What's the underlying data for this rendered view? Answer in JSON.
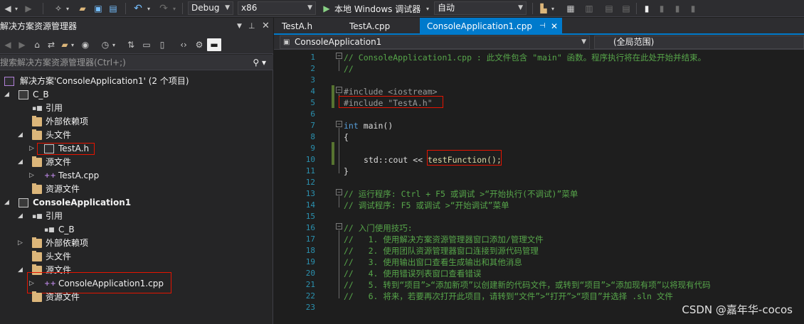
{
  "toolbar": {
    "config": "Debug",
    "platform": "x86",
    "run_label": "本地 Windows 调试器",
    "auto_label": "自动"
  },
  "solution_explorer": {
    "title": "解决方案资源管理器",
    "search_placeholder": "搜索解决方案资源管理器(Ctrl+;)",
    "tree": [
      {
        "label": "解决方案'ConsoleApplication1' (2 个项目)",
        "icon": "solution-icon"
      },
      {
        "label": "C_B",
        "icon": "project-icon"
      },
      {
        "label": "引用",
        "icon": "references-icon"
      },
      {
        "label": "外部依赖项",
        "icon": "external-deps-icon"
      },
      {
        "label": "头文件",
        "icon": "folder-icon"
      },
      {
        "label": "TestA.h",
        "icon": "header-file-icon"
      },
      {
        "label": "源文件",
        "icon": "folder-icon"
      },
      {
        "label": "TestA.cpp",
        "icon": "cpp-file-icon"
      },
      {
        "label": "资源文件",
        "icon": "folder-icon"
      },
      {
        "label": "ConsoleApplication1",
        "icon": "project-icon"
      },
      {
        "label": "引用",
        "icon": "references-icon"
      },
      {
        "label": "C_B",
        "icon": "reference-item-icon"
      },
      {
        "label": "外部依赖项",
        "icon": "external-deps-icon"
      },
      {
        "label": "头文件",
        "icon": "folder-icon"
      },
      {
        "label": "源文件",
        "icon": "folder-icon"
      },
      {
        "label": "ConsoleApplication1.cpp",
        "icon": "cpp-file-icon"
      },
      {
        "label": "资源文件",
        "icon": "folder-icon"
      }
    ]
  },
  "editor": {
    "tabs": [
      {
        "label": "TestA.h"
      },
      {
        "label": "TestA.cpp"
      },
      {
        "label": "ConsoleApplication1.cpp"
      }
    ],
    "nav_project": "ConsoleApplication1",
    "nav_scope": "(全局范围)",
    "line_numbers": [
      "1",
      "2",
      "3",
      "4",
      "5",
      "6",
      "7",
      "8",
      "9",
      "10",
      "11",
      "12",
      "13",
      "14",
      "15",
      "16",
      "17",
      "18",
      "19",
      "20",
      "21",
      "22",
      "23"
    ],
    "lines": {
      "l1": "// ConsoleApplication1.cpp : 此文件包含 \"main\" 函数。程序执行将在此处开始并结束。",
      "l2": "//",
      "l4": "#include <iostream>",
      "l5": "#include \"TestA.h\"",
      "l7_kw": "int",
      "l7_rest": " main()",
      "l8": "{",
      "l10_a": "std::cout << ",
      "l10_b": "testFunction();",
      "l11": "}",
      "l13": "// 运行程序: Ctrl + F5 或调试 >“开始执行(不调试)”菜单",
      "l14": "// 调试程序: F5 或调试 >“开始调试”菜单",
      "l16": "// 入门使用技巧:",
      "l17": "//   1. 使用解决方案资源管理器窗口添加/管理文件",
      "l18": "//   2. 使用团队资源管理器窗口连接到源代码管理",
      "l19": "//   3. 使用输出窗口查看生成输出和其他消息",
      "l20": "//   4. 使用错误列表窗口查看错误",
      "l21": "//   5. 转到“项目”>“添加新项”以创建新的代码文件，或转到“项目”>“添加现有项”以将现有代码",
      "l22": "//   6. 将来，若要再次打开此项目，请转到“文件”>“打开”>“项目”并选择 .sln 文件"
    }
  },
  "watermark": "CSDN @嘉年华-cocos",
  "colors": {
    "accent": "#007acc",
    "highlight_box": "#e51400",
    "comment": "#57a64a",
    "keyword": "#569cd6"
  }
}
